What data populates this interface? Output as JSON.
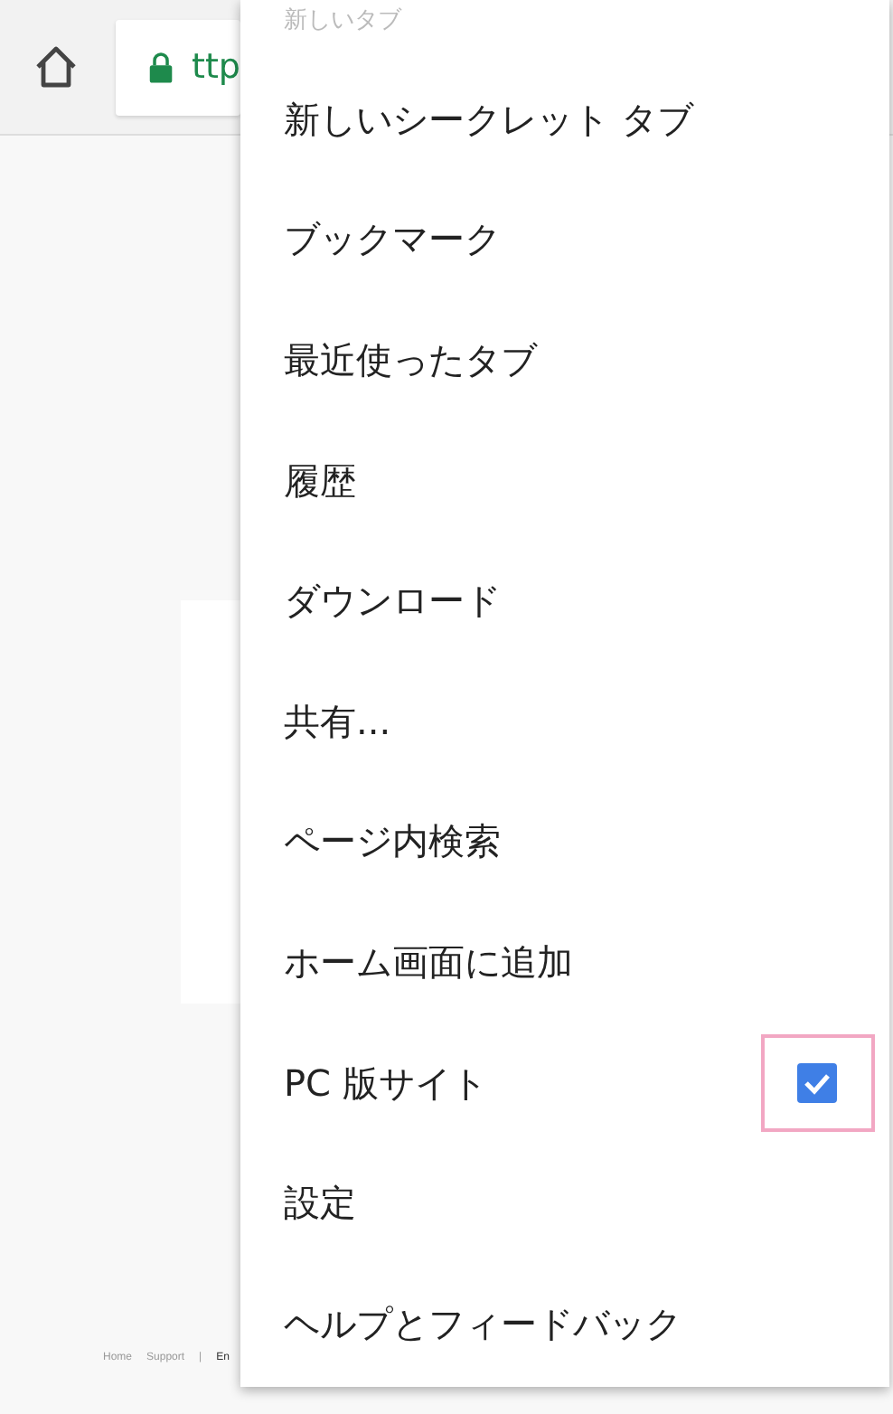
{
  "toolbar": {
    "url": "ttp"
  },
  "footer": {
    "links": [
      "Home",
      "Support",
      "|",
      "En"
    ]
  },
  "menu": {
    "items": [
      {
        "kind": "plain",
        "label": "新しいタブ",
        "cut": true
      },
      {
        "kind": "plain",
        "label": "新しいシークレット タブ"
      },
      {
        "kind": "plain",
        "label": "ブックマーク"
      },
      {
        "kind": "plain",
        "label": "最近使ったタブ"
      },
      {
        "kind": "plain",
        "label": "履歴"
      },
      {
        "kind": "plain",
        "label": "ダウンロード"
      },
      {
        "kind": "plain",
        "label": "共有..."
      },
      {
        "kind": "plain",
        "label": "ページ内検索"
      },
      {
        "kind": "plain",
        "label": "ホーム画面に追加"
      },
      {
        "kind": "checkbox",
        "label": "PC 版サイト",
        "checked": true,
        "highlighted": true
      },
      {
        "kind": "plain",
        "label": "設定"
      },
      {
        "kind": "plain",
        "label": "ヘルプとフィードバック"
      }
    ]
  }
}
